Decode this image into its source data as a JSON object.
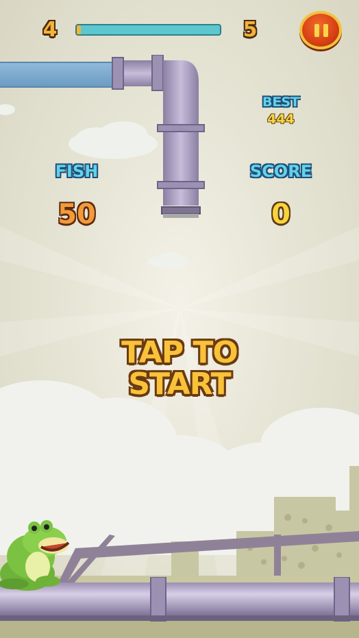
{
  "hud": {
    "current_level": "4",
    "next_level": "5",
    "progress": 0.03,
    "progress_track_color": "#5cc7cf",
    "progress_fill_color": "#f0b535",
    "pause_icon": "pause-icon"
  },
  "stats": {
    "best_label": "BEST",
    "best_value": "444",
    "fish_label": "FISH",
    "fish_value": "50",
    "score_label": "SCORE",
    "score_value": "0"
  },
  "prompt": {
    "line1": "TAP TO",
    "line2": "START"
  },
  "colors": {
    "sky": "#e6e4d4",
    "pipe": "#a79bbd",
    "water": "#7aa8cc",
    "frog": "#7cc242",
    "label_blue": "#62d2e8",
    "title_yellow": "#f8c23a"
  }
}
